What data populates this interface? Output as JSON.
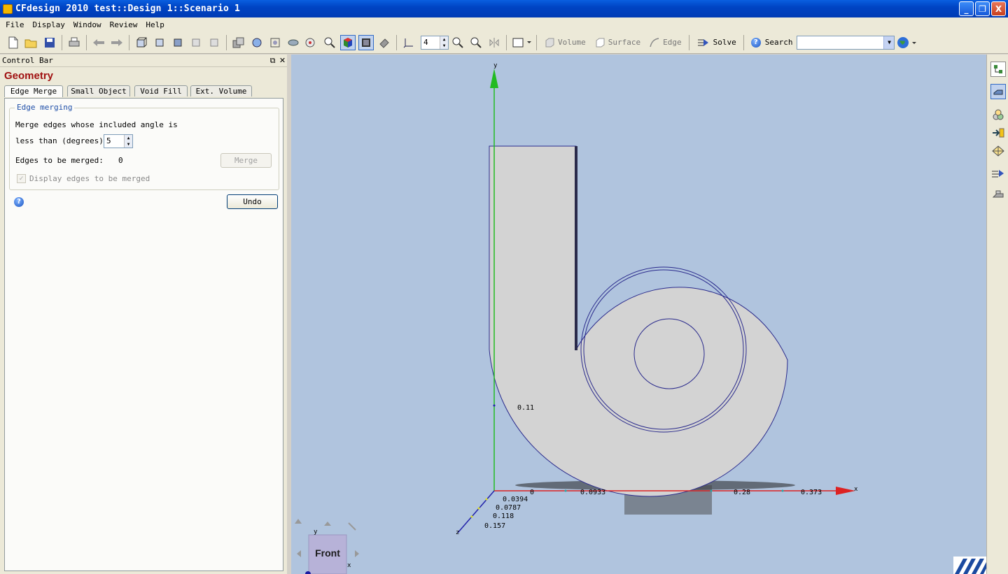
{
  "window": {
    "title": "CFdesign 2010    test::Design 1::Scenario 1",
    "buttons": [
      "_",
      "❐",
      "X"
    ]
  },
  "menu": [
    "File",
    "Display",
    "Window",
    "Review",
    "Help"
  ],
  "toolbar": {
    "view_level": "4",
    "volume_label": "Volume",
    "surface_label": "Surface",
    "edge_label": "Edge",
    "solve_label": "Solve",
    "search_label": "Search",
    "search_value": ""
  },
  "control_bar": {
    "header": "Control Bar",
    "title": "Geometry",
    "tabs": [
      "Edge Merge",
      "Small Object",
      "Void Fill",
      "Ext. Volume"
    ],
    "group_title": "Edge merging",
    "merge_text_line1": "Merge edges whose included angle is",
    "merge_text_line2": "less than (degrees):",
    "angle_value": "5",
    "edges_label": "Edges to be merged:",
    "edges_count": "0",
    "merge_button": "Merge",
    "display_edges_label": "Display edges to be merged",
    "display_edges_checked": true,
    "undo_button": "Undo"
  },
  "viewport": {
    "axis_y_label": "y",
    "axis_x_label": "x",
    "axis_z_label": "z",
    "y_tick": "0.11",
    "x_ticks": [
      "0",
      "0.0933",
      "0.28",
      "0.373"
    ],
    "z_ticks": [
      "0.0394",
      "0.0787",
      "0.118",
      "0.157"
    ],
    "viewcube_face": "Front",
    "viewcube_y": "y",
    "viewcube_x": "x"
  },
  "colors": {
    "titlebar": "#0044c4",
    "viewport_bg": "#b0c4de",
    "geometry_fill": "#d3d3d3",
    "geometry_edge": "#2a2a8c",
    "axis_y": "#22bb22",
    "axis_x": "#dd2222",
    "axis_z": "#2222aa",
    "title_red": "#a01010"
  }
}
